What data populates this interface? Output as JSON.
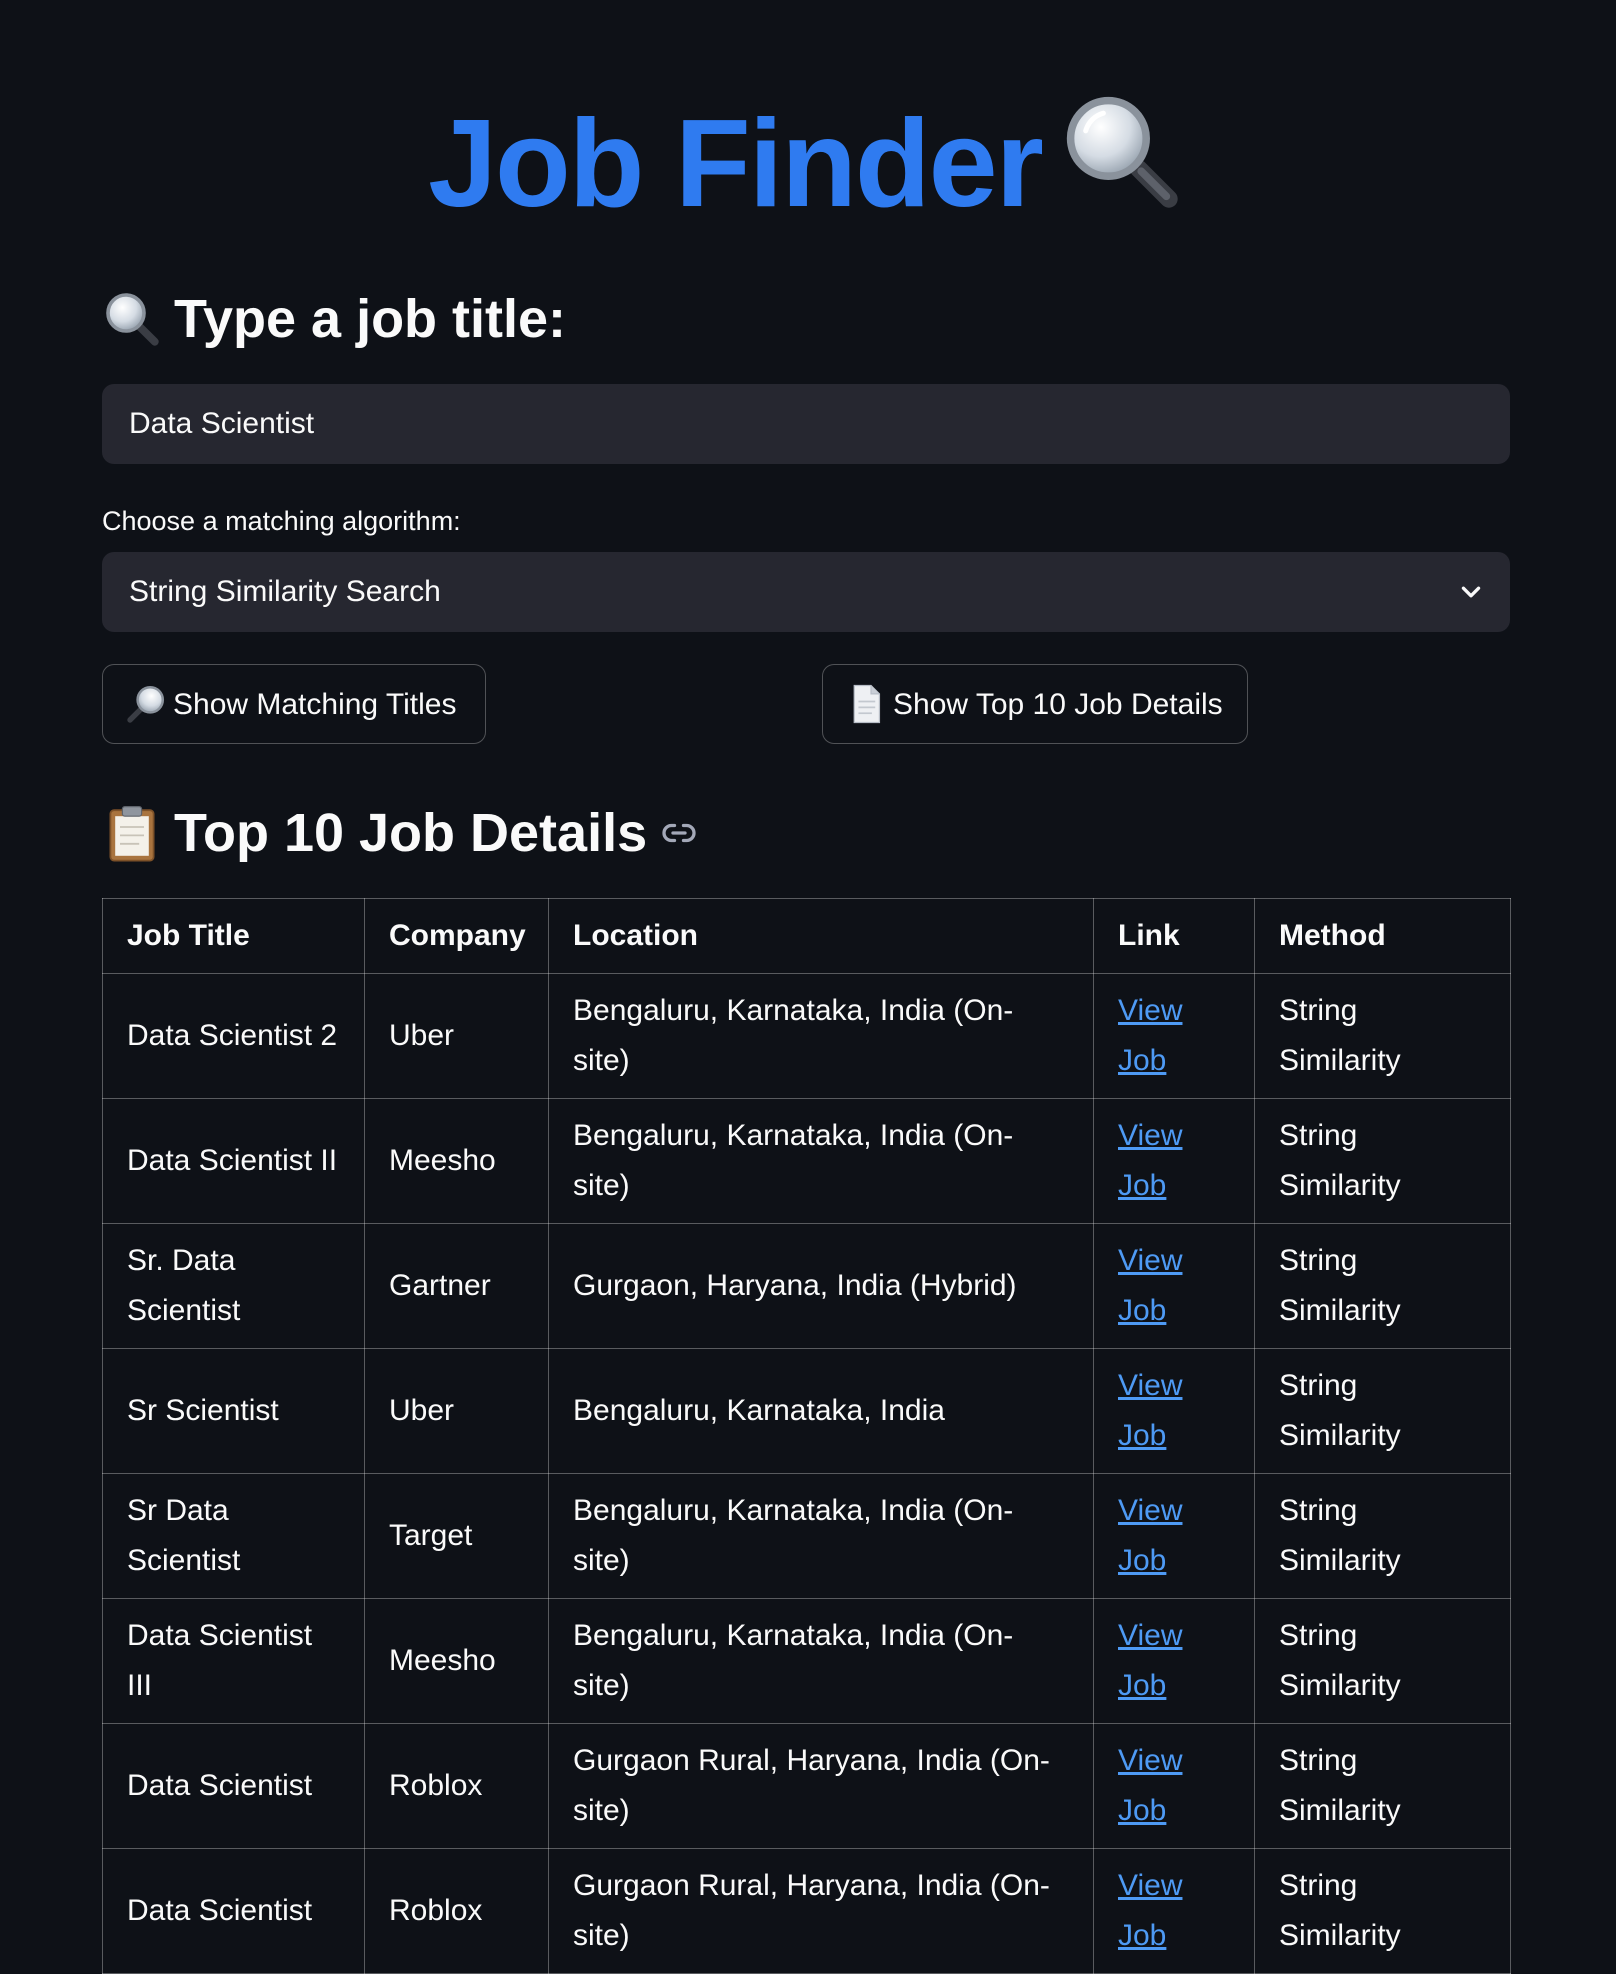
{
  "app": {
    "title": "Job Finder",
    "title_icon": "magnifying-glass-icon"
  },
  "search": {
    "heading": "Type a job title:",
    "heading_icon": "magnifying-glass-icon",
    "value": "Data Scientist"
  },
  "algorithm": {
    "label": "Choose a matching algorithm:",
    "selected": "String Similarity Search",
    "icon": "chevron-down-icon"
  },
  "buttons": {
    "show_titles": "Show Matching Titles",
    "show_titles_icon": "magnifying-glass-icon",
    "show_details": "Show Top 10 Job Details",
    "show_details_icon": "document-icon"
  },
  "results": {
    "heading": "Top 10 Job Details",
    "heading_icon": "clipboard-icon",
    "anchor_icon": "link-icon",
    "columns": [
      "Job Title",
      "Company",
      "Location",
      "Link",
      "Method"
    ],
    "rows": [
      {
        "title": "Data Scientist 2",
        "company": "Uber",
        "location": "Bengaluru, Karnataka, India (On-site)",
        "link": "View Job",
        "method": "String Similarity"
      },
      {
        "title": "Data Scientist II",
        "company": "Meesho",
        "location": "Bengaluru, Karnataka, India (On-site)",
        "link": "View Job",
        "method": "String Similarity"
      },
      {
        "title": "Sr. Data Scientist",
        "company": "Gartner",
        "location": "Gurgaon, Haryana, India (Hybrid)",
        "link": "View Job",
        "method": "String Similarity"
      },
      {
        "title": "Sr Scientist",
        "company": "Uber",
        "location": "Bengaluru, Karnataka, India",
        "link": "View Job",
        "method": "String Similarity"
      },
      {
        "title": "Sr Data Scientist",
        "company": "Target",
        "location": "Bengaluru, Karnataka, India (On-site)",
        "link": "View Job",
        "method": "String Similarity"
      },
      {
        "title": "Data Scientist III",
        "company": "Meesho",
        "location": "Bengaluru, Karnataka, India (On-site)",
        "link": "View Job",
        "method": "String Similarity"
      },
      {
        "title": "Data Scientist",
        "company": "Roblox",
        "location": "Gurgaon Rural, Haryana, India (On-site)",
        "link": "View Job",
        "method": "String Similarity"
      },
      {
        "title": "Data Scientist",
        "company": "Roblox",
        "location": "Gurgaon Rural, Haryana, India (On-site)",
        "link": "View Job",
        "method": "String Similarity"
      }
    ]
  },
  "colors": {
    "background": "#0e1117",
    "accent": "#2f7bf0",
    "link": "#4e9af4",
    "input_bg": "#262730"
  }
}
